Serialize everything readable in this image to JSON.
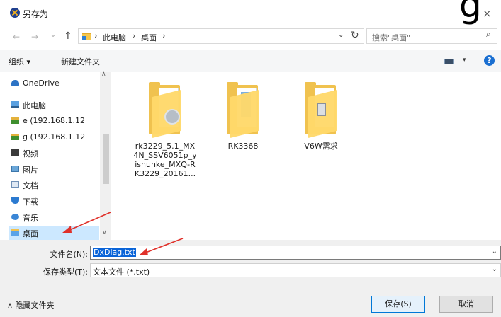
{
  "window": {
    "title": "另存为",
    "title_decoration": "g",
    "close_glyph": "×"
  },
  "nav": {
    "back_glyph": "←",
    "forward_glyph": "→",
    "recent_glyph": "⌄",
    "up_glyph": "↑",
    "breadcrumb": [
      "此电脑",
      "桌面"
    ],
    "crumb_separator": "›",
    "dropdown_glyph": "⌄",
    "refresh_glyph": "↻",
    "search_placeholder": "搜索\"桌面\"",
    "search_glyph": "⌕"
  },
  "toolbar": {
    "organize_label": "组织 ▾",
    "new_folder_label": "新建文件夹",
    "view_dropdown_glyph": "▾",
    "help_glyph": "?"
  },
  "sidebar": {
    "scroll_up_glyph": "∧",
    "scroll_down_glyph": "∨",
    "items": [
      {
        "label": "OneDrive",
        "icon": "onedrive-icon"
      },
      {
        "label": "此电脑",
        "icon": "this-pc-icon"
      },
      {
        "label": "e (192.168.1.12",
        "icon": "network-drive-icon"
      },
      {
        "label": "g (192.168.1.12",
        "icon": "network-drive-icon"
      },
      {
        "label": "视频",
        "icon": "videos-icon"
      },
      {
        "label": "图片",
        "icon": "pictures-icon"
      },
      {
        "label": "文档",
        "icon": "documents-icon"
      },
      {
        "label": "下载",
        "icon": "downloads-icon"
      },
      {
        "label": "音乐",
        "icon": "music-icon"
      },
      {
        "label": "桌面",
        "icon": "desktop-icon",
        "selected": true
      }
    ]
  },
  "files": [
    {
      "name_lines": [
        "rk3229_5.1_MX",
        "4N_SSV6051p_y",
        "ishunke_MXQ-R",
        "K3229_20161..."
      ],
      "icon": "folder-disc-icon"
    },
    {
      "name_lines": [
        "RK3368"
      ],
      "icon": "folder-docs-icon"
    },
    {
      "name_lines": [
        "V6W需求"
      ],
      "icon": "folder-printer-icon"
    }
  ],
  "form": {
    "filename_label": "文件名(N):",
    "filename_value": "DxDiag.txt",
    "filetype_label": "保存类型(T):",
    "filetype_value": "文本文件 (*.txt)",
    "dropdown_glyph": "⌄"
  },
  "footer": {
    "hide_folders_label": "∧ 隐藏文件夹",
    "save_label": "保存(S)",
    "cancel_label": "取消"
  },
  "colors": {
    "selection": "#0a64d8",
    "sidebar_selected": "#cce8ff",
    "annotation_arrow": "#e0312a"
  }
}
